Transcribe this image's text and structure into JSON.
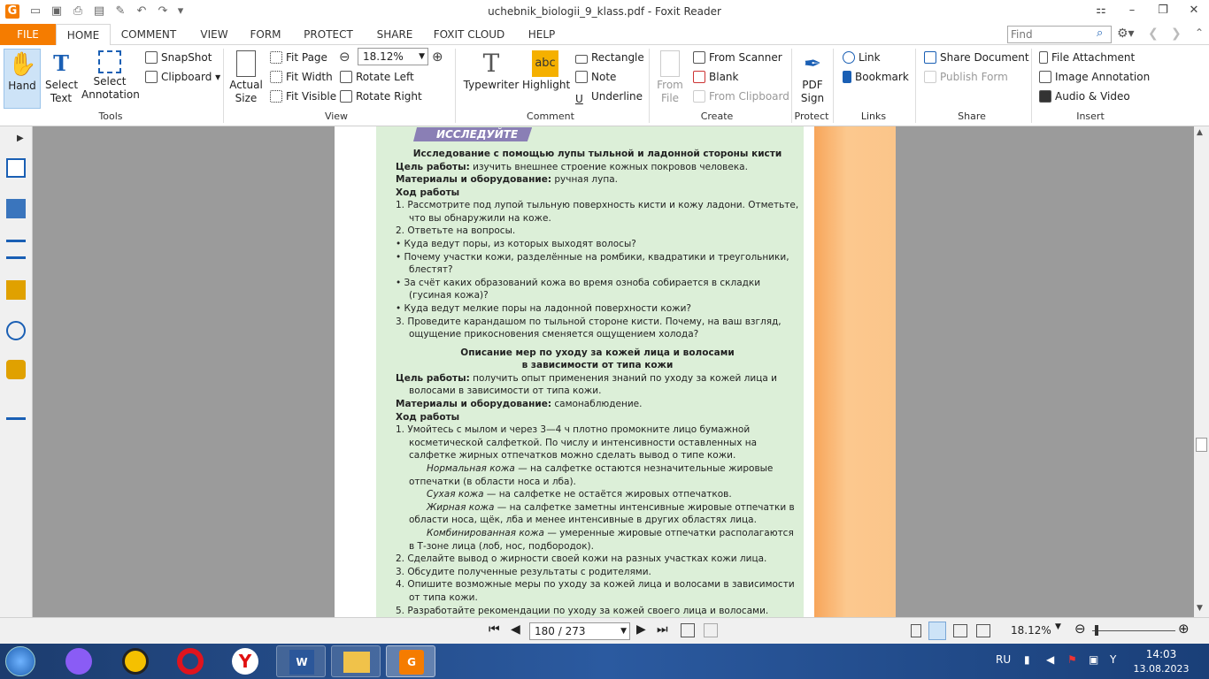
{
  "window": {
    "title": "uchebnik_biologii_9_klass.pdf - Foxit Reader"
  },
  "menu": {
    "file": "FILE",
    "tabs": [
      "HOME",
      "COMMENT",
      "VIEW",
      "FORM",
      "PROTECT",
      "SHARE",
      "FOXIT CLOUD",
      "HELP"
    ],
    "find_placeholder": "Find"
  },
  "ribbon": {
    "tools": {
      "hand": "Hand",
      "select_text": "Select Text",
      "select_annotation": "Select Annotation",
      "snapshot": "SnapShot",
      "clipboard": "Clipboard",
      "label": "Tools"
    },
    "view": {
      "actual_size": "Actual Size",
      "fit_page": "Fit Page",
      "fit_width": "Fit Width",
      "fit_visible": "Fit Visible",
      "zoom": "18.12%",
      "rotate_left": "Rotate Left",
      "rotate_right": "Rotate Right",
      "label": "View"
    },
    "comment": {
      "typewriter": "Typewriter",
      "highlight": "Highlight",
      "rectangle": "Rectangle",
      "note": "Note",
      "underline": "Underline",
      "label": "Comment"
    },
    "create": {
      "from_file": "From File",
      "from_scanner": "From Scanner",
      "blank": "Blank",
      "from_clipboard": "From Clipboard",
      "label": "Create"
    },
    "protect": {
      "pdf_sign": "PDF Sign",
      "label": "Protect"
    },
    "links": {
      "link": "Link",
      "bookmark": "Bookmark",
      "label": "Links"
    },
    "share": {
      "share_document": "Share Document",
      "publish_form": "Publish Form",
      "label": "Share"
    },
    "insert": {
      "file_attachment": "File Attachment",
      "image_annotation": "Image Annotation",
      "audio_video": "Audio & Video",
      "label": "Insert"
    }
  },
  "doc": {
    "banner": "ИССЛЕДУЙТЕ",
    "s1_title": "Исследование с помощью лупы тыльной и ладонной стороны кисти",
    "s1_goal_label": "Цель работы:",
    "s1_goal": " изучить внешнее строение кожных покровов человека.",
    "s1_mat_label": "Материалы и оборудование:",
    "s1_mat": " ручная лупа.",
    "s1_course": "Ход работы",
    "s1_l1": "1. Рассмотрите под лупой тыльную поверхность кисти и кожу ладони. Отметьте, что вы обнаружили на коже.",
    "s1_l2": "2. Ответьте на вопросы.",
    "s1_b1": "• Куда ведут поры, из которых выходят волосы?",
    "s1_b2": "• Почему участки кожи, разделённые на ромбики, квадратики и треугольники, блестят?",
    "s1_b3": "• За счёт каких образований кожа во время озноба собирается в складки (гусиная кожа)?",
    "s1_b4": "• Куда ведут мелкие поры на ладонной поверхности кожи?",
    "s1_l3": "3. Проведите карандашом по тыльной стороне кисти. Почему, на ваш взгляд, ощущение прикосновения сменяется ощущением холода?",
    "s2_title1": "Описание мер по уходу за кожей лица и волосами",
    "s2_title2": "в зависимости от типа кожи",
    "s2_goal_label": "Цель работы:",
    "s2_goal": " получить опыт применения знаний по уходу за кожей лица и волосами в зависимости от типа кожи.",
    "s2_mat_label": "Материалы и оборудование:",
    "s2_mat": " самонаблюдение.",
    "s2_course": "Ход работы",
    "s2_l1": "1. Умойтесь с мылом и через 3—4 ч плотно промокните лицо бумажной косметической салфеткой. По числу и интенсивности оставленных на салфетке жирных отпечатков можно сделать вывод о типе кожи.",
    "s2_p1_i": "Нормальная кожа",
    "s2_p1": " — на салфетке остаются незначительные жировые отпечатки (в области носа и лба).",
    "s2_p2_i": "Сухая кожа",
    "s2_p2": " — на салфетке не остаётся жировых отпечатков.",
    "s2_p3_i": "Жирная кожа",
    "s2_p3": " — на салфетке заметны интенсивные жировые отпечатки в области носа, щёк, лба и менее интенсивные в других областях лица.",
    "s2_p4_i": "Комбинированная кожа",
    "s2_p4": " — умеренные жировые отпечатки располагаются в Т-зоне лица (лоб, нос, подбородок).",
    "s2_l2": "2. Сделайте вывод о жирности своей кожи на разных участках кожи лица.",
    "s2_l3": "3. Обсудите полученные результаты с родителями.",
    "s2_l4": "4. Опишите возможные меры по уходу за кожей лица и волосами в зависимости от типа кожи.",
    "s2_l5": "5. Разработайте рекомендации по уходу за кожей своего лица и волосами."
  },
  "status": {
    "page": "180 / 273",
    "zoom": "18.12%"
  },
  "taskbar": {
    "lang": "RU",
    "time": "14:03",
    "date": "13.08.2023"
  },
  "colors": {
    "file_tab": "#f57c00",
    "page_bg": "#dcefd8",
    "banner": "#8a7fb5"
  }
}
